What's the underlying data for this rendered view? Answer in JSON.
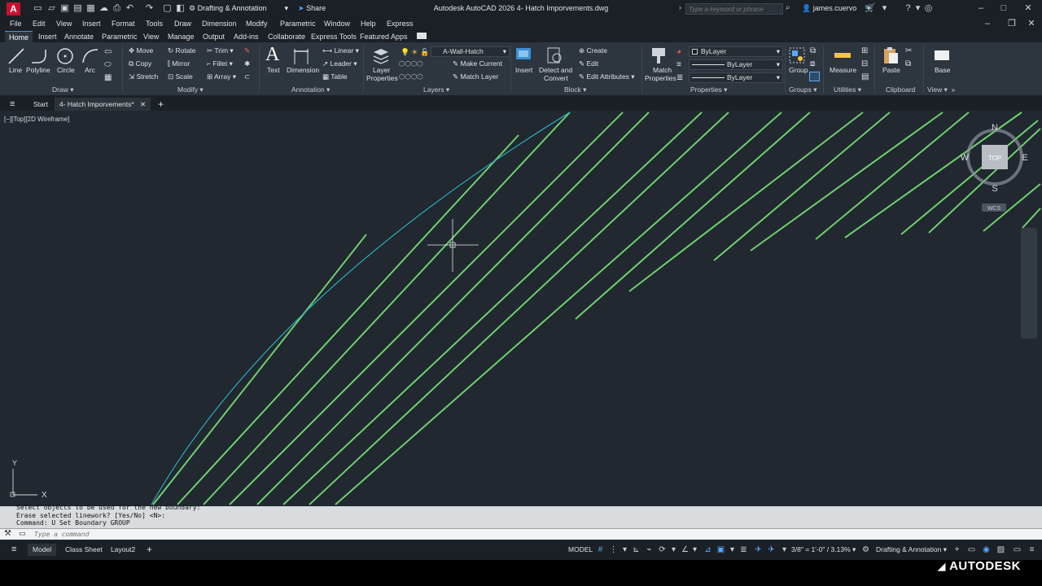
{
  "titlebar": {
    "workspace": "Drafting & Annotation",
    "share": "Share",
    "title": "Autodesk AutoCAD 2026   4- Hatch Imporvements.dwg",
    "search_placeholder": "Type a keyword or phrase",
    "user": "james.cuervo",
    "logo": "A"
  },
  "menu": [
    "File",
    "Edit",
    "View",
    "Insert",
    "Format",
    "Tools",
    "Draw",
    "Dimension",
    "Modify",
    "Parametric",
    "Window",
    "Help",
    "Express"
  ],
  "ribbon_tabs": [
    "Home",
    "Insert",
    "Annotate",
    "Parametric",
    "View",
    "Manage",
    "Output",
    "Add-ins",
    "Collaborate",
    "Express Tools",
    "Featured Apps"
  ],
  "ribbon": {
    "draw": {
      "title": "Draw",
      "line": "Line",
      "polyline": "Polyline",
      "circle": "Circle",
      "arc": "Arc"
    },
    "modify": {
      "title": "Modify",
      "move": "Move",
      "rotate": "Rotate",
      "trim": "Trim",
      "copy": "Copy",
      "mirror": "Mirror",
      "fillet": "Fillet",
      "stretch": "Stretch",
      "scale": "Scale",
      "array": "Array"
    },
    "annotation": {
      "title": "Annotation",
      "text": "Text",
      "dimension": "Dimension",
      "linear": "Linear",
      "leader": "Leader",
      "table": "Table"
    },
    "layers": {
      "title": "Layers",
      "layer_properties_1": "Layer",
      "layer_properties_2": "Properties",
      "current_layer": "A-Wall-Hatch",
      "make_current": "Make Current",
      "match_layer": "Match Layer"
    },
    "block": {
      "title": "Block",
      "insert": "Insert",
      "detect_1": "Detect and",
      "detect_2": "Convert",
      "create": "Create",
      "edit": "Edit",
      "edit_attributes": "Edit Attributes"
    },
    "properties": {
      "title": "Properties",
      "match_1": "Match",
      "match_2": "Properties",
      "color": "ByLayer",
      "linetype": "ByLayer",
      "lineweight": "ByLayer"
    },
    "groups": {
      "title": "Groups",
      "group": "Group"
    },
    "utilities": {
      "title": "Utilities",
      "measure": "Measure"
    },
    "clipboard": {
      "title": "Clipboard",
      "paste": "Paste"
    },
    "view": {
      "title": "View",
      "base": "Base"
    }
  },
  "file_tabs": {
    "start": "Start",
    "doc": "4- Hatch Imporvements*"
  },
  "viewport_label": "[−][Top][2D Wireframe]",
  "viewcube": {
    "n": "N",
    "s": "S",
    "e": "E",
    "w": "W",
    "top": "TOP",
    "wcs": "WCS"
  },
  "ucs": {
    "x": "X",
    "y": "Y"
  },
  "command": {
    "history": [
      "Select objects to be used for the new boundary:",
      "Erase selected linework? [Yes/No] <N>:",
      "Command: U Set Boundary GROUP"
    ],
    "placeholder": "Type a command"
  },
  "status": {
    "tabs": [
      "Model",
      "Class Sheet",
      "Layout2"
    ],
    "model_label": "MODEL",
    "scale": "3/8\" = 1'-0\" / 3.13%",
    "workspace": "Drafting & Annotation"
  },
  "brand": "AUTODESK",
  "colors": {
    "hatch": "#6fcf6f",
    "boundary": "#2bb7c7",
    "background": "#212830"
  }
}
